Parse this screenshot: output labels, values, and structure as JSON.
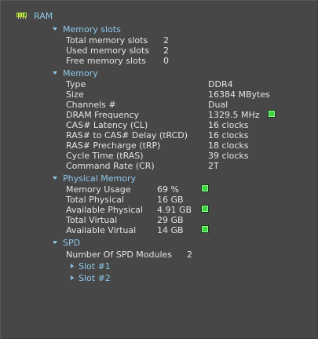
{
  "root": {
    "label": "RAM",
    "icon": "ram-module-icon"
  },
  "memory_slots": {
    "label": "Memory slots",
    "rows": [
      {
        "label": "Total memory slots",
        "value": "2"
      },
      {
        "label": "Used memory slots",
        "value": "2"
      },
      {
        "label": "Free memory slots",
        "value": "0"
      }
    ]
  },
  "memory": {
    "label": "Memory",
    "rows": [
      {
        "label": "Type",
        "value": "DDR4"
      },
      {
        "label": "Size",
        "value": "16384 MBytes"
      },
      {
        "label": "Channels #",
        "value": "Dual"
      },
      {
        "label": "DRAM Frequency",
        "value": "1329.5 MHz"
      },
      {
        "label": "CAS# Latency (CL)",
        "value": "16 clocks"
      },
      {
        "label": "RAS# to CAS# Delay (tRCD)",
        "value": "16 clocks"
      },
      {
        "label": "RAS# Precharge (tRP)",
        "value": "18 clocks"
      },
      {
        "label": "Cycle Time (tRAS)",
        "value": "39 clocks"
      },
      {
        "label": "Command Rate (CR)",
        "value": "2T"
      }
    ]
  },
  "physical_memory": {
    "label": "Physical Memory",
    "rows": [
      {
        "label": "Memory Usage",
        "value": "69 %"
      },
      {
        "label": "Total Physical",
        "value": "16 GB"
      },
      {
        "label": "Available Physical",
        "value": "4.91 GB"
      },
      {
        "label": "Total Virtual",
        "value": "29 GB"
      },
      {
        "label": "Available Virtual",
        "value": "14 GB"
      }
    ]
  },
  "spd": {
    "label": "SPD",
    "modules_label": "Number Of SPD Modules",
    "modules_value": "2",
    "slots": [
      {
        "label": "Slot #1"
      },
      {
        "label": "Slot #2"
      }
    ]
  },
  "colors": {
    "background": "#474747",
    "node_text": "#8ec8ea",
    "text": "#e4e4e4",
    "indicator": "#3cd63c"
  }
}
